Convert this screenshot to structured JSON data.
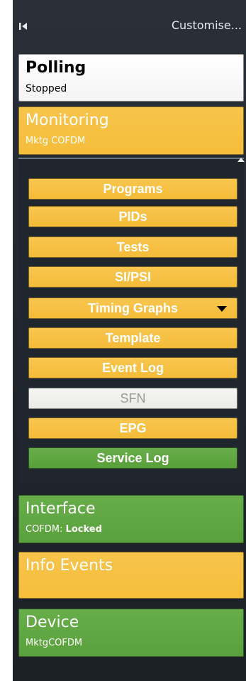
{
  "topbar": {
    "customise_label": "Customise..."
  },
  "sections": {
    "polling": {
      "title": "Polling",
      "status": "Stopped"
    },
    "monitoring": {
      "title": "Monitoring",
      "subtitle": "Mktg COFDM"
    },
    "interface": {
      "title": "Interface",
      "status_prefix": "COFDM: ",
      "status_value": "Locked"
    },
    "info_events": {
      "title": "Info Events"
    },
    "device": {
      "title": "Device",
      "subtitle": "MktgCOFDM"
    }
  },
  "monitoring_menu": {
    "items": [
      {
        "label": "Programs"
      },
      {
        "label": "PIDs"
      },
      {
        "label": "Tests"
      },
      {
        "label": "SI/PSI"
      },
      {
        "label": "Timing Graphs"
      },
      {
        "label": "Template"
      },
      {
        "label": "Event Log"
      },
      {
        "label": "SFN"
      },
      {
        "label": "EPG"
      },
      {
        "label": "Service Log"
      }
    ]
  },
  "icons": {
    "collapse": "collapse-left-icon",
    "dropdown": "chevron-down-icon",
    "scroll_up": "scroll-up-icon"
  },
  "colors": {
    "panel_bg": "#20262d",
    "yellow": "#f5bd3a",
    "green": "#5aa03c",
    "white_card": "#ffffff",
    "disabled": "#ebebe7"
  }
}
